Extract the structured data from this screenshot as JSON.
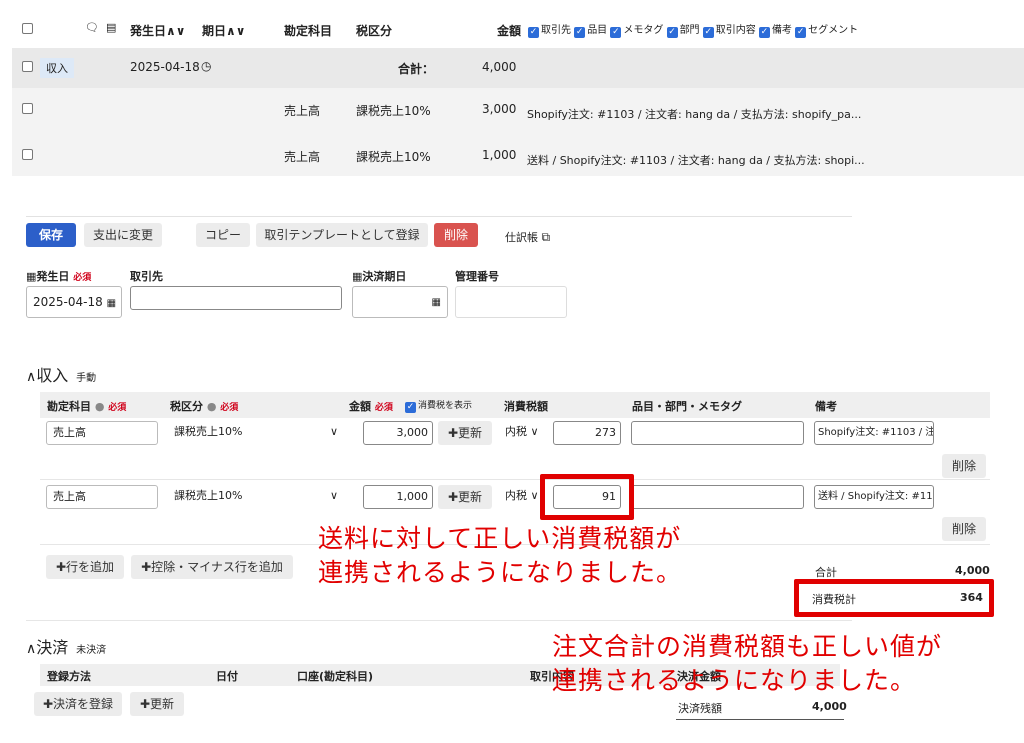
{
  "list": {
    "headers": {
      "date": "発生日",
      "due": "期日",
      "account": "勘定科目",
      "tax": "税区分",
      "amount": "金額"
    },
    "column_toggles": [
      "取引先",
      "品目",
      "メモタグ",
      "部門",
      "取引内容",
      "備考",
      "セグメント"
    ],
    "summary": {
      "type_badge": "収入",
      "date": "2025-04-18",
      "total_label": "合計：",
      "total": "4,000"
    },
    "rows": [
      {
        "account": "売上高",
        "tax": "課税売上10%",
        "amount": "3,000",
        "note": "Shopify注文: #1103 / 注文者: hang da / 支払方法: shopify_pa..."
      },
      {
        "account": "売上高",
        "tax": "課税売上10%",
        "amount": "1,000",
        "note": "送料 / Shopify注文: #1103 / 注文者: hang da / 支払方法: shopi..."
      }
    ]
  },
  "actions": {
    "save": "保存",
    "to_expense": "支出に変更",
    "copy": "コピー",
    "template": "取引テンプレートとして登録",
    "delete": "削除",
    "journal": "仕訳帳"
  },
  "form": {
    "date_label": "発生日",
    "required": "必須",
    "date_value": "2025-04-18",
    "partner_label": "取引先",
    "due_label": "決済期日",
    "manage_label": "管理番号"
  },
  "income": {
    "title": "収入",
    "mode": "手動",
    "headers": {
      "account": "勘定科目",
      "tax": "税区分",
      "amount": "金額",
      "show_tax": "消費税を表示",
      "tax_amount": "消費税額",
      "items": "品目・部門・メモタグ",
      "note": "備考"
    },
    "rows": [
      {
        "account": "売上高",
        "tax": "課税売上10%",
        "amount": "3,000",
        "update": "更新",
        "tax_mode": "内税",
        "tax_amount": "273",
        "note": "Shopify注文: #1103 / 注:",
        "delete": "削除"
      },
      {
        "account": "売上高",
        "tax": "課税売上10%",
        "amount": "1,000",
        "update": "更新",
        "tax_mode": "内税",
        "tax_amount": "91",
        "note": "送料 / Shopify注文: #110",
        "delete": "削除"
      }
    ],
    "add_row": "行を追加",
    "add_minus": "控除・マイナス行を追加",
    "total_label": "合計",
    "total": "4,000",
    "tax_total_label": "消費税計",
    "tax_total": "364"
  },
  "settlement": {
    "title": "決済",
    "status": "未決済",
    "headers": {
      "method": "登録方法",
      "date": "日付",
      "account": "口座(勘定科目)",
      "content": "取引内容",
      "amount": "決済金額"
    },
    "register": "決済を登録",
    "update": "更新",
    "balance_label": "決済残額",
    "balance": "4,000"
  },
  "annotations": {
    "a1_line1": "送料に対して正しい消費税額が",
    "a1_line2": "連携されるようになりました。",
    "a2_line1": "注文合計の消費税額も正しい値が",
    "a2_line2": "連携されるようになりました。"
  },
  "colors": {
    "accent": "#2c5fc9",
    "danger": "#d9534f",
    "annotation": "#e10000"
  }
}
